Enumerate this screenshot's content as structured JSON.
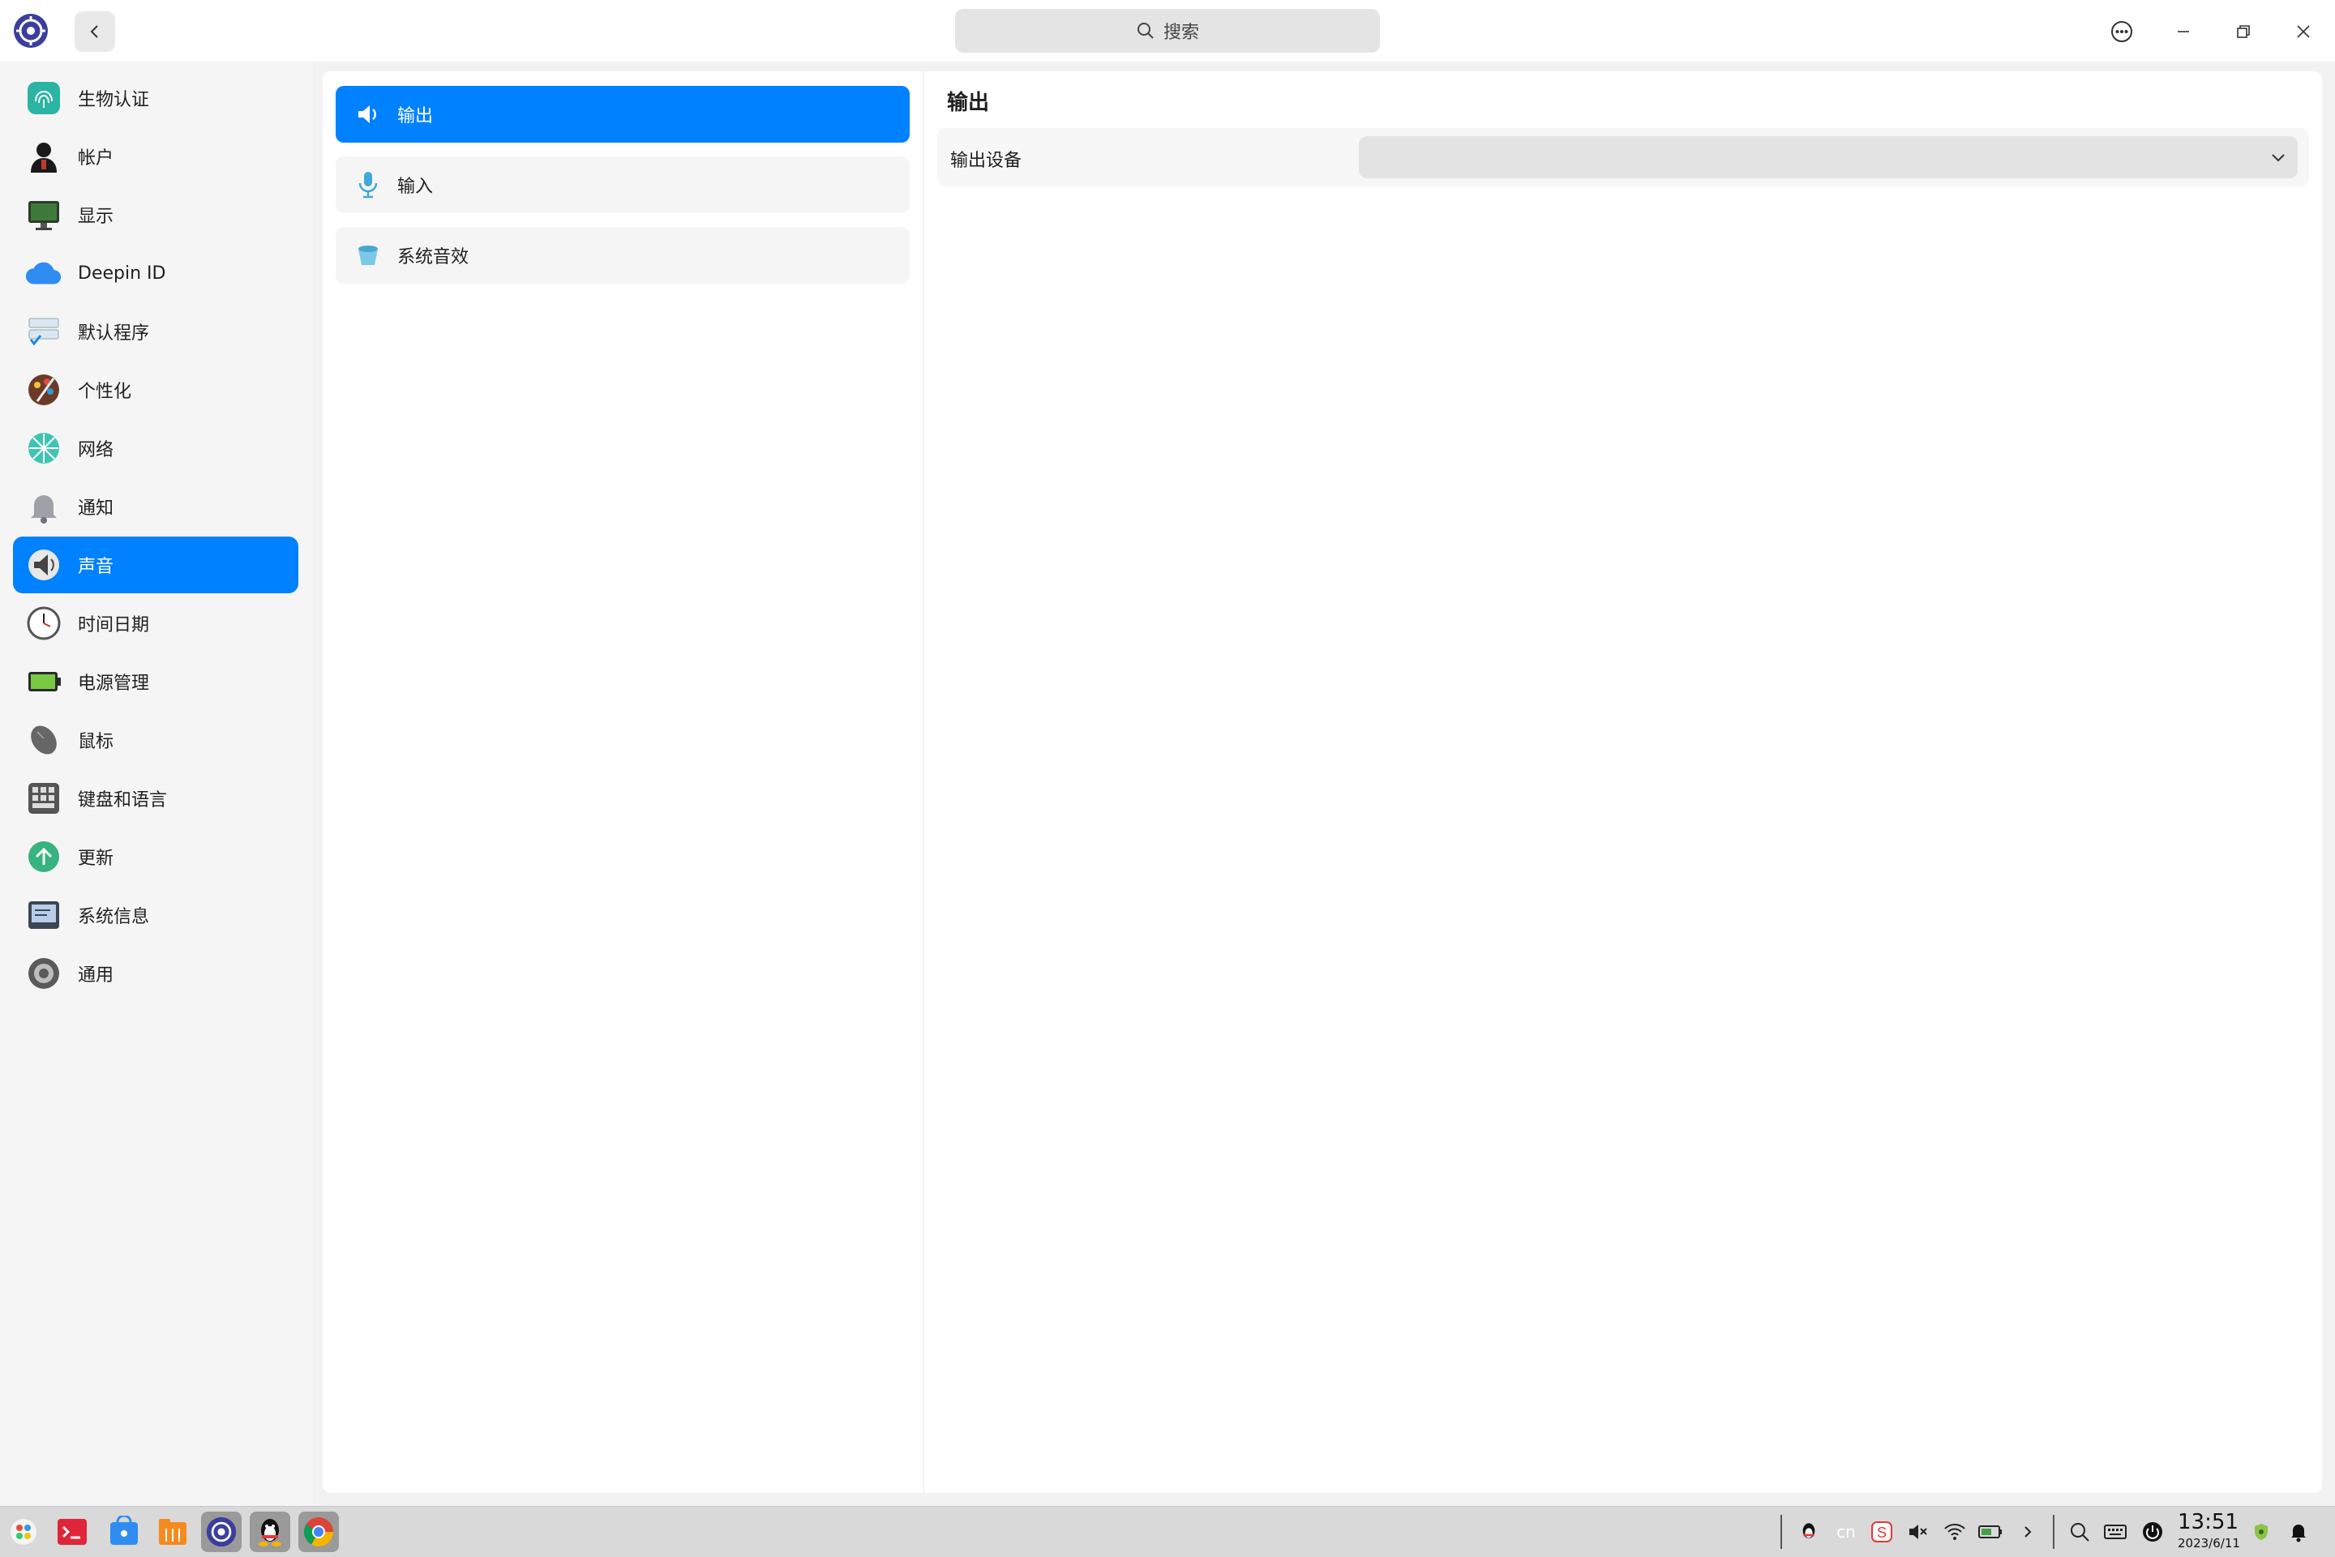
{
  "window": {
    "search_placeholder": "搜索"
  },
  "sidebar": {
    "items": [
      {
        "label": "生物认证",
        "icon": "fingerprint-icon"
      },
      {
        "label": "帐户",
        "icon": "account-icon"
      },
      {
        "label": "显示",
        "icon": "display-icon"
      },
      {
        "label": "Deepin ID",
        "icon": "cloud-icon"
      },
      {
        "label": "默认程序",
        "icon": "default-apps-icon"
      },
      {
        "label": "个性化",
        "icon": "personalization-icon"
      },
      {
        "label": "网络",
        "icon": "network-icon"
      },
      {
        "label": "通知",
        "icon": "bell-icon"
      },
      {
        "label": "声音",
        "icon": "speaker-icon"
      },
      {
        "label": "时间日期",
        "icon": "clock-icon"
      },
      {
        "label": "电源管理",
        "icon": "battery-icon"
      },
      {
        "label": "鼠标",
        "icon": "mouse-icon"
      },
      {
        "label": "键盘和语言",
        "icon": "keyboard-icon"
      },
      {
        "label": "更新",
        "icon": "update-icon"
      },
      {
        "label": "系统信息",
        "icon": "system-info-icon"
      },
      {
        "label": "通用",
        "icon": "general-icon"
      }
    ],
    "active_index": 8
  },
  "sound_menu": {
    "items": [
      {
        "label": "输出",
        "icon": "speaker-output-icon"
      },
      {
        "label": "输入",
        "icon": "microphone-icon"
      },
      {
        "label": "系统音效",
        "icon": "sound-effects-icon"
      }
    ],
    "active_index": 0
  },
  "output": {
    "section_title": "输出",
    "device_label": "输出设备",
    "device_value": ""
  },
  "taskbar": {
    "apps": [
      "launcher-icon",
      "terminal-icon",
      "app-store-icon",
      "file-manager-icon",
      "control-center-icon",
      "qq-icon",
      "chrome-icon"
    ],
    "tray": {
      "input_method": "cn",
      "time": "13:51",
      "date": "2023/6/11"
    }
  },
  "colors": {
    "accent": "#0081ff",
    "sidebar_bg": "#f5f5f5",
    "panel_bg": "#ffffff",
    "taskbar_bg": "#d9d9d9"
  }
}
